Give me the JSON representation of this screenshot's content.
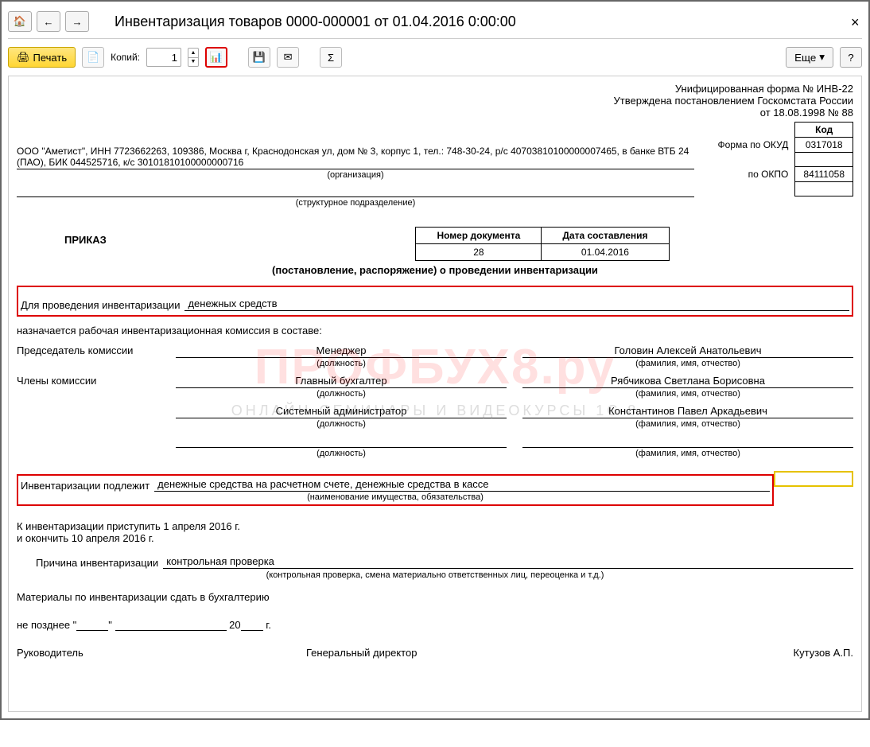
{
  "title": "Инвентаризация товаров 0000-000001 от 01.04.2016 0:00:00",
  "toolbar": {
    "print": "Печать",
    "copies_label": "Копий:",
    "copies_value": "1",
    "more": "Еще",
    "help": "?"
  },
  "watermark": {
    "main": "ПРОФБУХ8.ру",
    "sub": "ОНЛАЙН-СЕМИНАРЫ И ВИДЕОКУРСЫ 1С 8"
  },
  "header": {
    "line1": "Унифицированная форма № ИНВ-22",
    "line2": "Утверждена постановлением Госкомстата России",
    "line3": "от 18.08.1998 № 88"
  },
  "codes": {
    "kod_header": "Код",
    "okud_label": "Форма по ОКУД",
    "okud_value": "0317018",
    "okpo_label": "по ОКПО",
    "okpo_value": "84111058"
  },
  "org": {
    "text": "ООО \"Аметист\", ИНН 7723662263, 109386, Москва г, Краснодонская ул, дом № 3, корпус 1, тел.: 748-30-24, р/с 40703810100000007465, в банке ВТБ 24 (ПАО), БИК 044525716, к/с 30101810100000000716",
    "sub": "(организация)",
    "unit_sub": "(структурное подразделение)"
  },
  "docnum": {
    "num_header": "Номер документа",
    "date_header": "Дата составления",
    "num": "28",
    "date": "01.04.2016"
  },
  "order": {
    "title": "ПРИКАЗ",
    "sub": "(постановление, распоряжение) о проведении инвентаризации"
  },
  "fields": {
    "for_label": "Для проведения инвентаризации",
    "for_value": "денежных средств",
    "commission": "назначается рабочая инвентаризационная комиссия в составе:",
    "chairman_label": "Председатель комиссии",
    "members_label": "Члены комиссии",
    "position_sub": "(должность)",
    "fio_sub": "(фамилия, имя, отчество)",
    "subject_label": "Инвентаризации подлежит",
    "subject_value": "денежные средства на расчетном счете, денежные средства в кассе",
    "subject_sub": "(наименование имущества, обязательства)",
    "start": "К инвентаризации приступить 1 апреля 2016 г.",
    "end": "и окончить 10 апреля 2016 г.",
    "reason_label": "Причина инвентаризации",
    "reason_value": "контрольная проверка",
    "reason_sub": "(контрольная проверка, смена материально ответственных лиц, переоценка и т.д.)",
    "materials": "Материалы по инвентаризации сдать в бухгалтерию",
    "deadline_prefix": "не позднее \"",
    "deadline_mid": "\" ",
    "deadline_year": "20",
    "deadline_suffix": " г.",
    "head_label": "Руководитель",
    "head_position": "Генеральный директор",
    "head_fio": "Кутузов А.П."
  },
  "members": {
    "chairman": {
      "position": "Менеджер",
      "fio": "Головин Алексей Анатольевич"
    },
    "m1": {
      "position": "Главный бухгалтер",
      "fio": "Рябчикова Светлана Борисовна"
    },
    "m2": {
      "position": "Системный администратор",
      "fio": "Константинов Павел Аркадьевич"
    },
    "m3": {
      "position": "",
      "fio": ""
    }
  }
}
